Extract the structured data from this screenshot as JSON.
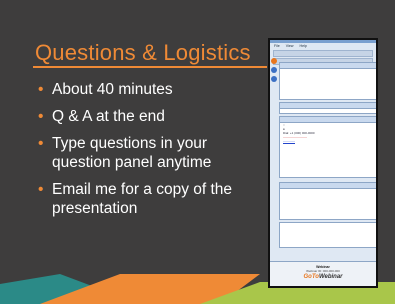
{
  "slide": {
    "title": "Questions & Logistics",
    "bullets": [
      "About 40 minutes",
      "Q & A at the end",
      "Type questions in your question panel anytime",
      "Email me for a copy of the presentation"
    ],
    "colors": {
      "background": "#3e3d3d",
      "accent": "#ef8a36",
      "text": "#ffffff"
    }
  },
  "panel": {
    "menu": [
      "File",
      "View",
      "Help"
    ],
    "dial_number": "Dial: +1 (000) 000-0000",
    "webinar_id": "Webinar ID: 000-000-000",
    "logo_pre": "GoTo",
    "logo_post": "Webinar",
    "footer_title": "Webinar"
  }
}
